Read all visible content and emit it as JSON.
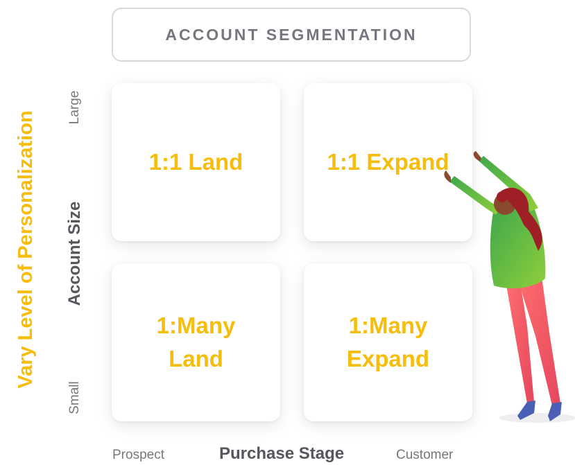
{
  "header": {
    "title": "ACCOUNT SEGMENTATION"
  },
  "side": {
    "title": "Vary Level of Personalization"
  },
  "y_axis": {
    "label": "Account Size",
    "top_tick": "Large",
    "bottom_tick": "Small"
  },
  "x_axis": {
    "label": "Purchase Stage",
    "left_tick": "Prospect",
    "right_tick": "Customer"
  },
  "quadrants": {
    "top_left": "1:1 Land",
    "top_right": "1:1 Expand",
    "bottom_left": "1:Many\nLand",
    "bottom_right": "1:Many\nExpand"
  },
  "colors": {
    "accent": "#f6bd0c",
    "text_gray": "#56565c",
    "border": "#d8d8d8"
  }
}
